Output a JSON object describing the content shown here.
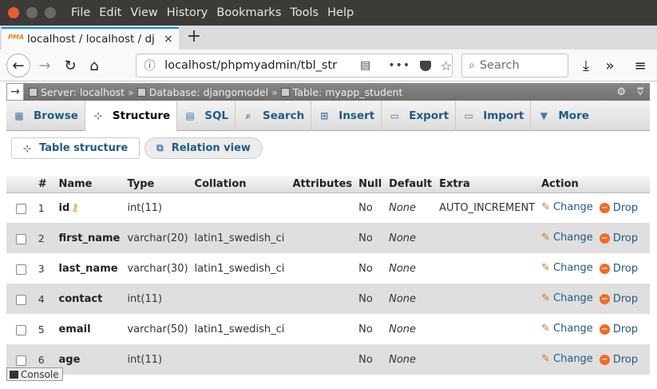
{
  "menu": [
    "File",
    "Edit",
    "View",
    "History",
    "Bookmarks",
    "Tools",
    "Help"
  ],
  "tab": {
    "favicon": "PMA",
    "title": "localhost / localhost / dj",
    "close": "×",
    "new_tab": "+"
  },
  "nav": {
    "url": "localhost/phpmyadmin/tbl_str",
    "search_placeholder": "Search"
  },
  "breadcrumb": {
    "server": "Server: localhost",
    "database": "Database: djangomodel",
    "table": "Table: myapp_student",
    "sep": "»"
  },
  "pma_tabs": [
    {
      "label": "Browse",
      "icon": "browse-icon"
    },
    {
      "label": "Structure",
      "icon": "structure-icon"
    },
    {
      "label": "SQL",
      "icon": "sql-icon"
    },
    {
      "label": "Search",
      "icon": "search-icon"
    },
    {
      "label": "Insert",
      "icon": "insert-icon"
    },
    {
      "label": "Export",
      "icon": "export-icon"
    },
    {
      "label": "Import",
      "icon": "import-icon"
    },
    {
      "label": "More",
      "icon": "chevron-down-icon"
    }
  ],
  "subtabs": {
    "table_structure": "Table structure",
    "relation_view": "Relation view"
  },
  "columns": {
    "hash": "#",
    "name": "Name",
    "type": "Type",
    "collation": "Collation",
    "attributes": "Attributes",
    "null": "Null",
    "default": "Default",
    "extra": "Extra",
    "action": "Action"
  },
  "rows": [
    {
      "num": "1",
      "name": "id",
      "type": "int(11)",
      "collation": "",
      "null": "No",
      "default": "None",
      "extra": "AUTO_INCREMENT"
    },
    {
      "num": "2",
      "name": "first_name",
      "type": "varchar(20)",
      "collation": "latin1_swedish_ci",
      "null": "No",
      "default": "None",
      "extra": ""
    },
    {
      "num": "3",
      "name": "last_name",
      "type": "varchar(30)",
      "collation": "latin1_swedish_ci",
      "null": "No",
      "default": "None",
      "extra": ""
    },
    {
      "num": "4",
      "name": "contact",
      "type": "int(11)",
      "collation": "",
      "null": "No",
      "default": "None",
      "extra": ""
    },
    {
      "num": "5",
      "name": "email",
      "type": "varchar(50)",
      "collation": "latin1_swedish_ci",
      "null": "No",
      "default": "None",
      "extra": ""
    },
    {
      "num": "6",
      "name": "age",
      "type": "int(11)",
      "collation": "",
      "null": "No",
      "default": "None",
      "extra": ""
    }
  ],
  "actions": {
    "change": "Change",
    "drop": "Drop"
  },
  "console": "Console"
}
